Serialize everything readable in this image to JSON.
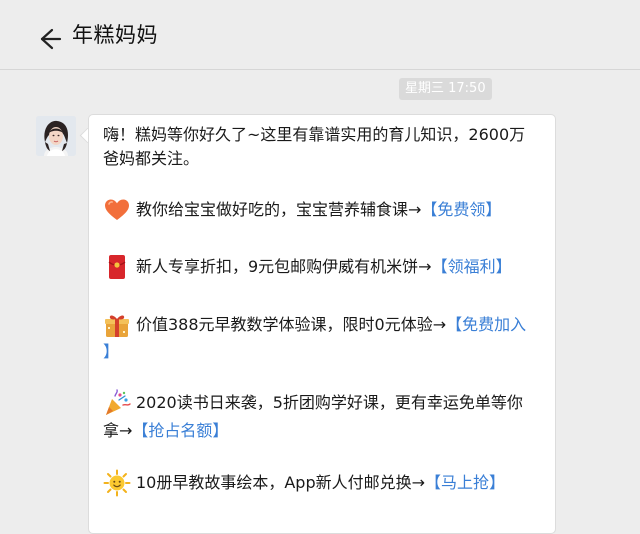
{
  "header": {
    "title": "年糕妈妈"
  },
  "chat": {
    "timestamp": "星期三 17:50",
    "message": {
      "intro_line1": "嗨！糕妈等你好久了~这里有靠谱实用的育儿知识，2600万",
      "intro_line2": "爸妈都关注。",
      "items": [
        {
          "icon": "heart-icon",
          "text": "教你给宝宝做好吃的，宝宝营养辅食课→",
          "link": "【免费领】"
        },
        {
          "icon": "red-envelope-icon",
          "text": "新人专享折扣，9元包邮购伊威有机米饼→",
          "link": "【领福利】"
        },
        {
          "icon": "gift-icon",
          "text": "价值388元早教数学体验课，限时0元体验→",
          "link": "【免费加入",
          "link_cont": "】"
        },
        {
          "icon": "party-popper-icon",
          "text": "2020读书日来袭，5折团购学好课，更有幸运免单等你",
          "text_cont": "拿→",
          "link": "【抢占名额】"
        },
        {
          "icon": "sun-icon",
          "text": "10册早教故事绘本，App新人付邮兑换→",
          "link": "【马上抢】"
        }
      ]
    }
  },
  "colors": {
    "background": "#ededed",
    "bubble": "#ffffff",
    "link": "#3a7fd6",
    "badge": "#dadada"
  }
}
